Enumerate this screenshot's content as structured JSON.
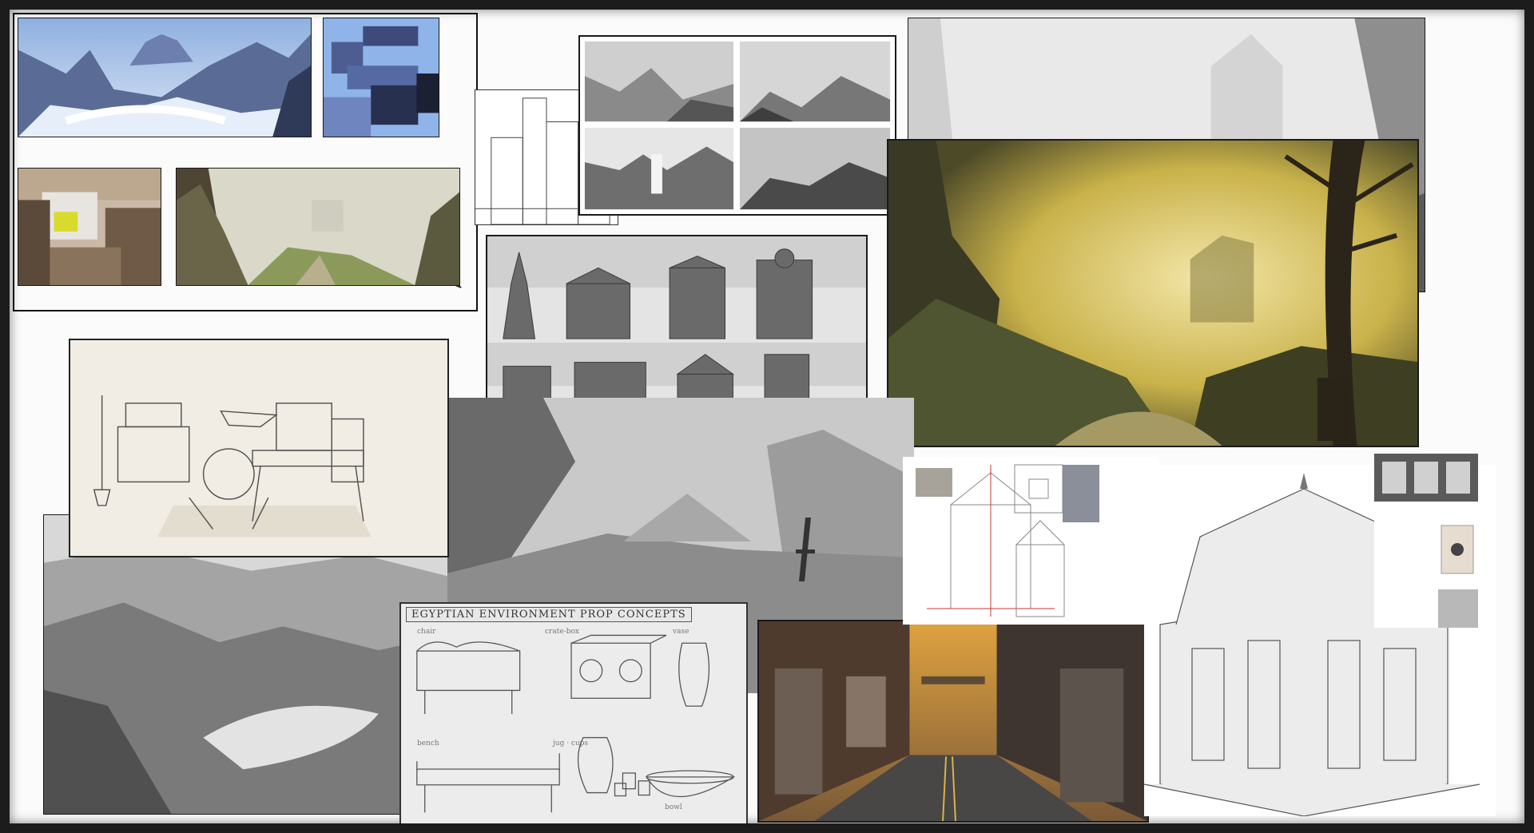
{
  "board": {
    "background_color": "#fbfbfb",
    "frame_color": "#1c1c1c"
  },
  "panels": {
    "snow_landscape": {
      "icon": "snowy-mountain-painting"
    },
    "blue_blockin": {
      "icon": "color-block-study"
    },
    "yellow_blockin": {
      "icon": "color-block-study"
    },
    "green_valley": {
      "icon": "valley-painting"
    },
    "grey_thumbnails": {
      "icon": "thumbnail-sketches"
    },
    "building_lineart": {
      "icon": "building-lineart"
    },
    "towers_sheet": {
      "icon": "tower-designs"
    },
    "blacksmith_props": {
      "icon": "workshop-prop-sketch"
    },
    "grey_valley": {
      "icon": "grey-valley-painting"
    },
    "misty_grey": {
      "icon": "misty-valley-painting"
    },
    "yellow_forest": {
      "icon": "forest-ruins-painting",
      "accent_color": "#c9b24a"
    },
    "top_right_grey": {
      "icon": "grey-cliffs-painting"
    },
    "church_blueprint": {
      "icon": "church-blueprint"
    },
    "egyptian_props": {
      "title": "EGYPTIAN ENVIRONMENT PROP CONCEPTS",
      "labels": {
        "chair": "chair",
        "crate_box": "crate-box",
        "vase": "vase",
        "bench": "bench",
        "jug_cups": "jug · cups",
        "bowl": "bowl"
      }
    },
    "city_street": {
      "icon": "city-street-render",
      "accent_color": "#e0a23e"
    },
    "building_model": {
      "icon": "ornate-building-model"
    },
    "texture_samples": {
      "icon": "ornament-textures"
    }
  }
}
